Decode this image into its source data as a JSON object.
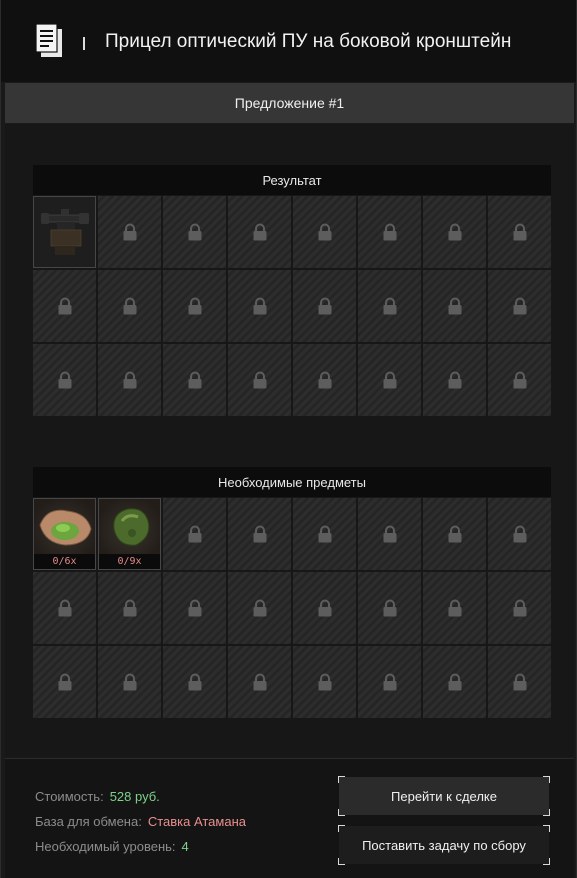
{
  "header": {
    "title": "Прицел оптический ПУ на боковой кронштейн",
    "icon": "document-icon"
  },
  "offer": {
    "label": "Предложение #1"
  },
  "result": {
    "heading": "Результат",
    "rows": 3,
    "columns": 8,
    "items": [
      {
        "name": "scope-item-icon",
        "icon": "scope-icon"
      }
    ]
  },
  "required": {
    "heading": "Необходимые предметы",
    "rows": 3,
    "columns": 8,
    "items": [
      {
        "name": "required-item-1",
        "icon": "food-pack-icon",
        "count": "0/6x"
      },
      {
        "name": "required-item-2",
        "icon": "green-stone-icon",
        "count": "0/9x"
      }
    ]
  },
  "footer": {
    "cost_label": "Стоимость:",
    "cost_value": "528 руб.",
    "base_label": "База для обмена:",
    "base_value": "Ставка Атамана",
    "level_label": "Необходимый уровень:",
    "level_value": "4",
    "go_to_deal": "Перейти к сделке",
    "set_task": "Поставить задачу по сбору"
  },
  "colors": {
    "accent_green": "#7fd18a",
    "accent_red": "#e88f8f",
    "count_red": "#e68a8a"
  }
}
